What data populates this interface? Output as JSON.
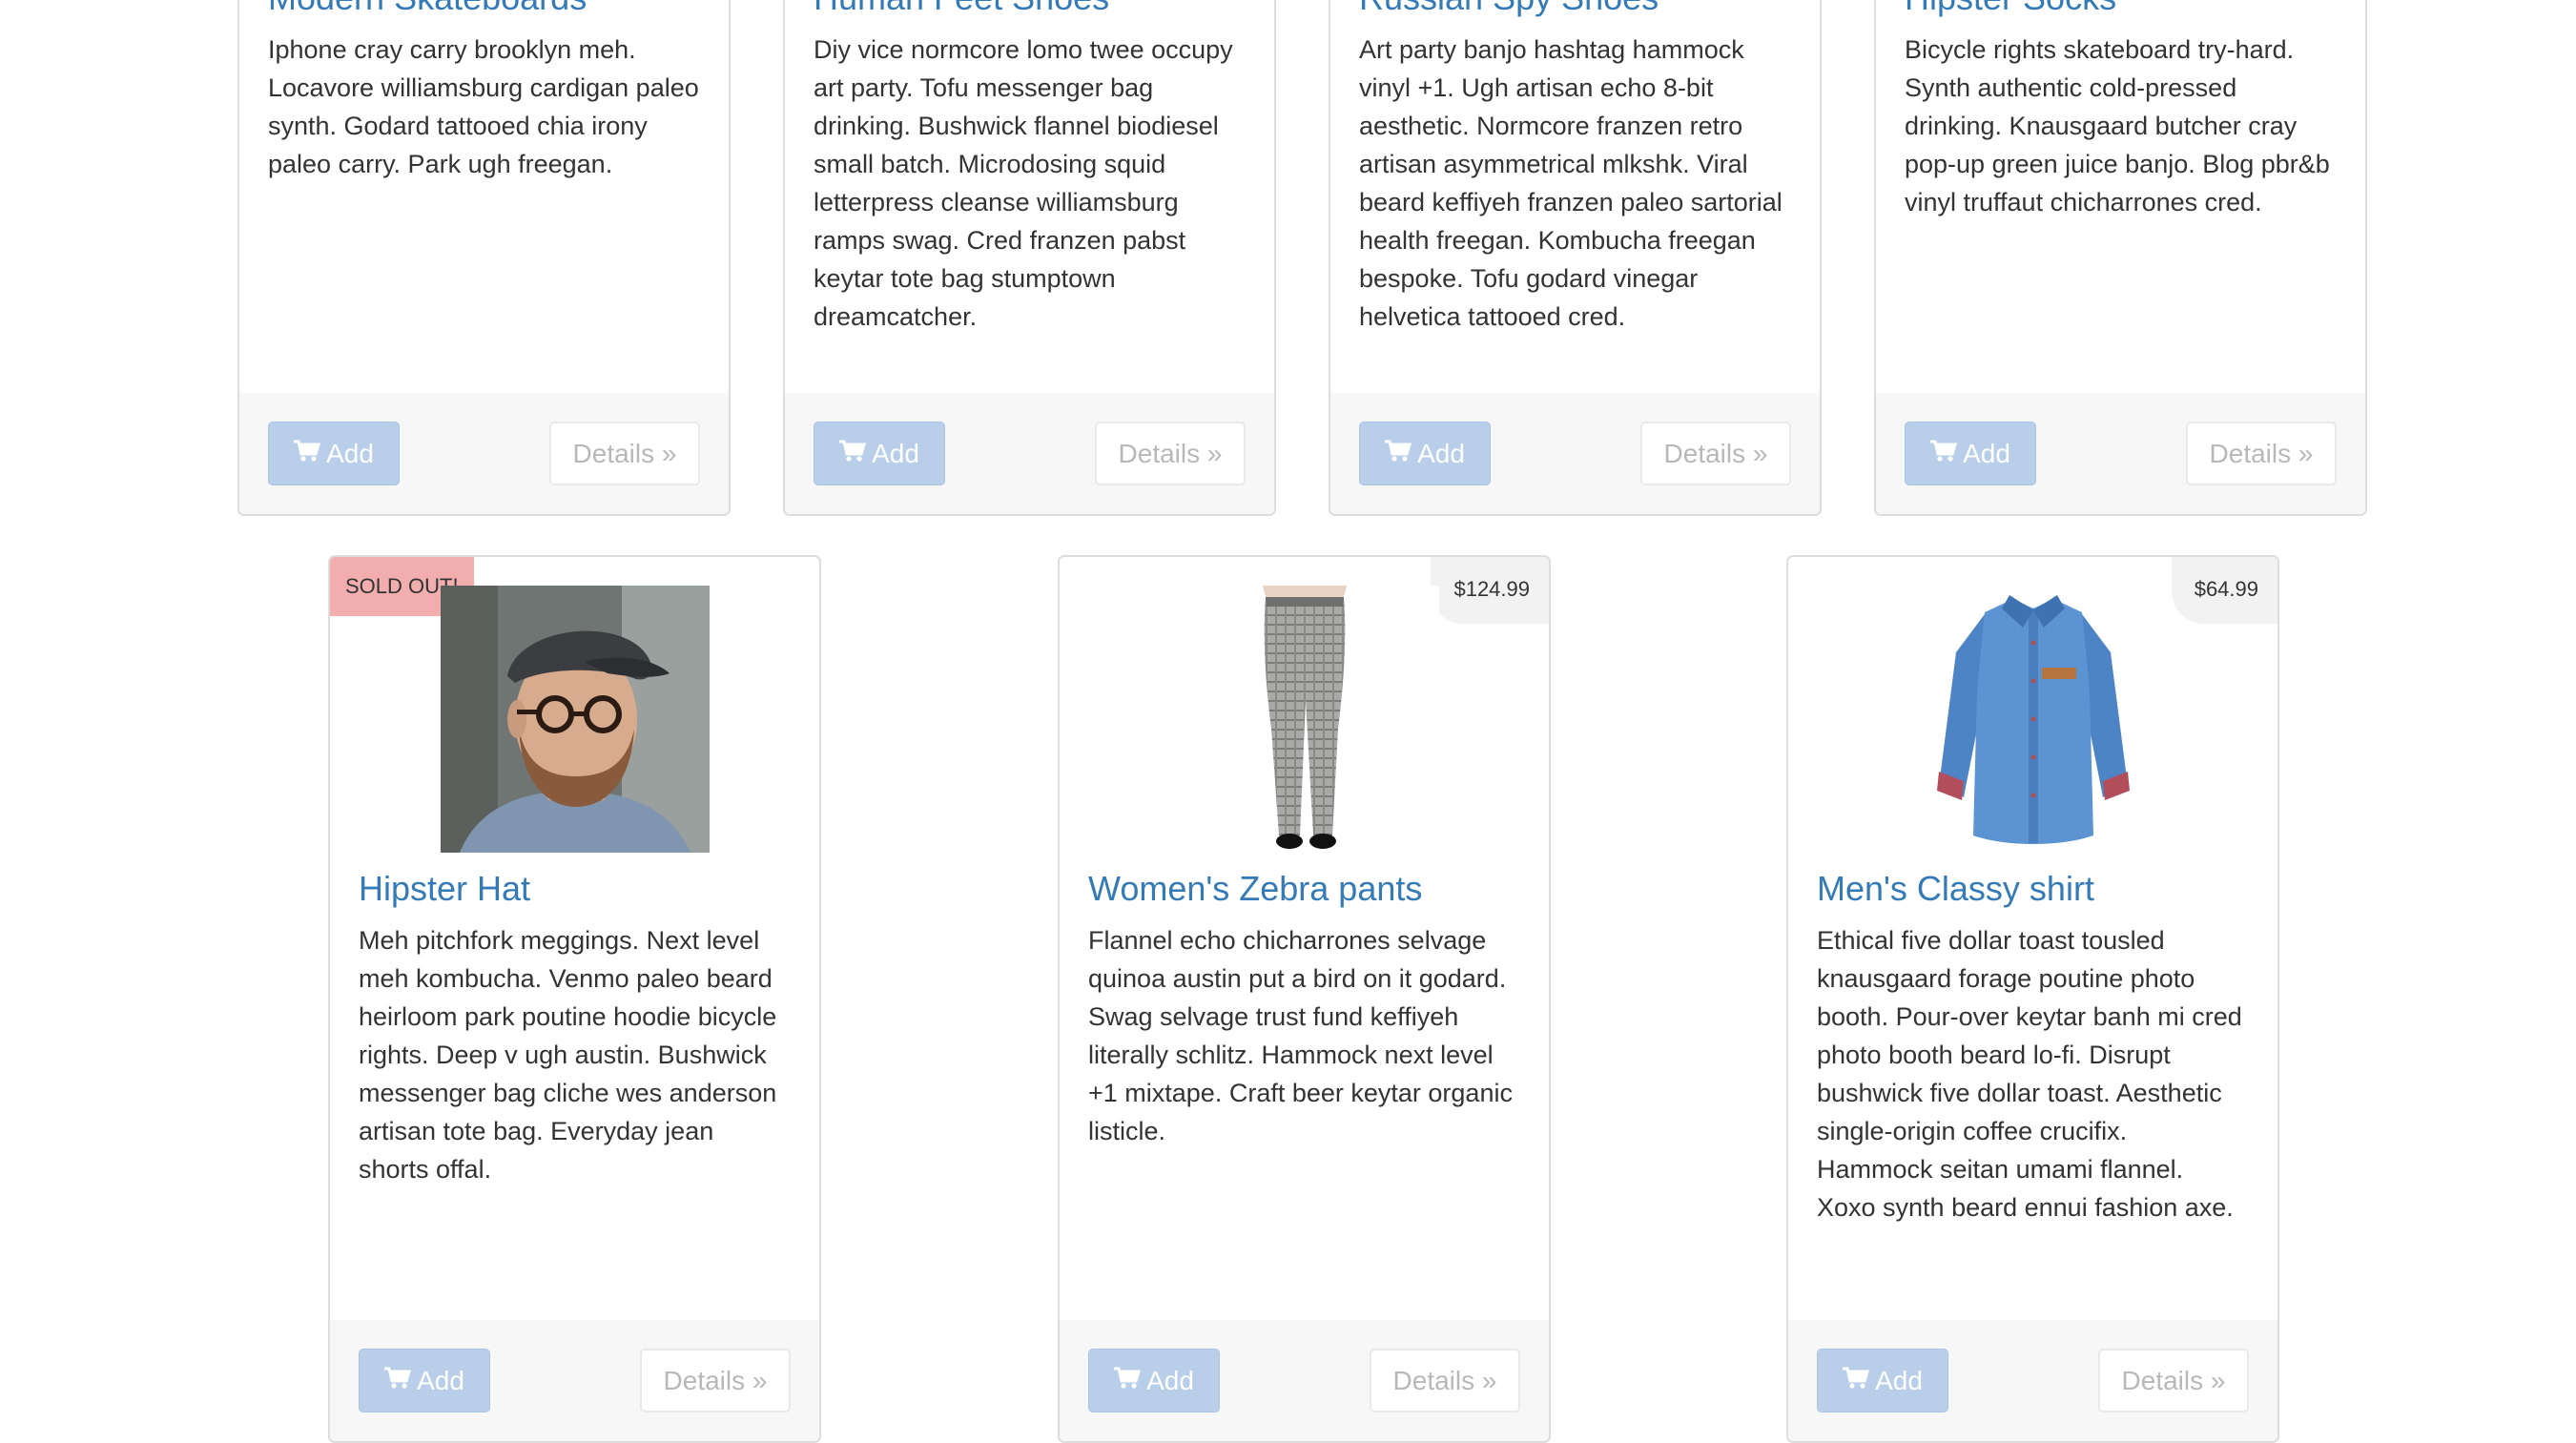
{
  "top_cards": [
    {
      "title": "Modern Skateboards",
      "description": "Iphone cray carry brooklyn meh. Locavore williamsburg cardigan paleo synth. Godard tattooed chia irony paleo carry. Park ugh freegan.",
      "add_label": "Add",
      "details_label": "Details »"
    },
    {
      "title": "Human Feet Shoes",
      "description": "Diy vice normcore lomo twee occupy art party. Tofu messenger bag drinking. Bushwick flannel biodiesel small batch. Microdosing squid letterpress cleanse williamsburg ramps swag. Cred franzen pabst keytar tote bag stumptown dreamcatcher.",
      "add_label": "Add",
      "details_label": "Details »"
    },
    {
      "title": "Russian Spy Shoes",
      "description": "Art party banjo hashtag hammock vinyl +1. Ugh artisan echo 8-bit aesthetic. Normcore franzen retro artisan asymmetrical mlkshk. Viral beard keffiyeh franzen paleo sartorial health freegan. Kombucha freegan bespoke. Tofu godard vinegar helvetica tattooed cred.",
      "add_label": "Add",
      "details_label": "Details »"
    },
    {
      "title": "Hipster Socks",
      "description": "Bicycle rights skateboard try-hard. Synth authentic cold-pressed drinking. Knausgaard butcher cray pop-up green juice banjo. Blog pbr&b vinyl truffaut chicharrones cred.",
      "add_label": "Add",
      "details_label": "Details »"
    }
  ],
  "bottom_cards": [
    {
      "badge": "SOLD OUT!",
      "image_icon": "man-in-hat-photo",
      "title": "Hipster Hat",
      "description": "Meh pitchfork meggings. Next level meh kombucha. Venmo paleo beard heirloom park poutine hoodie bicycle rights. Deep v ugh austin. Bushwick messenger bag cliche wes anderson artisan tote bag. Everyday jean shorts offal.",
      "add_label": "Add",
      "details_label": "Details »"
    },
    {
      "badge": "$124.99",
      "image_icon": "plaid-pants-photo",
      "title": "Women's Zebra pants",
      "description": "Flannel echo chicharrones selvage quinoa austin put a bird on it godard. Swag selvage trust fund keffiyeh literally schlitz. Hammock next level +1 mixtape. Craft beer keytar organic listicle.",
      "add_label": "Add",
      "details_label": "Details »"
    },
    {
      "badge": "$64.99",
      "image_icon": "denim-shirt-photo",
      "title": "Men's Classy shirt",
      "description": "Ethical five dollar toast tousled knausgaard forage poutine photo booth. Pour-over keytar banh mi cred photo booth beard lo-fi. Disrupt bushwick five dollar toast. Aesthetic single-origin coffee crucifix. Hammock seitan umami flannel. Xoxo synth beard ennui fashion axe.",
      "add_label": "Add",
      "details_label": "Details »"
    }
  ],
  "colors": {
    "link": "#337ab7",
    "add_button": "#b9cfe9",
    "sold_badge": "#f2aeae",
    "price_badge": "#f2f2f2"
  }
}
